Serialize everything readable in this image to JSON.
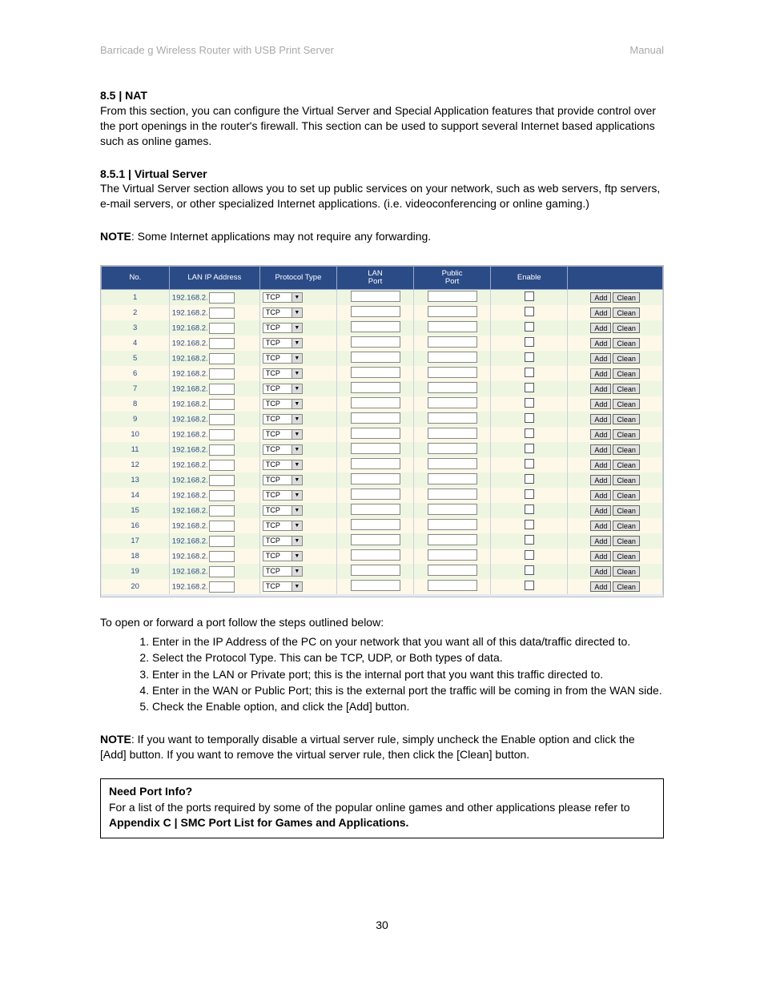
{
  "header": {
    "left": "Barricade g Wireless Router with USB Print Server",
    "right": "Manual"
  },
  "sec1": {
    "title": "8.5 | NAT",
    "text": "From this section, you can configure the Virtual Server and Special Application features that provide control over the port openings in the router's firewall. This section can be used to support several Internet based applications such as online games."
  },
  "sec2": {
    "title": "8.5.1 | Virtual Server",
    "text": "The Virtual Server section allows you to set up public services on your network, such as web servers, ftp servers, e-mail servers, or other specialized Internet applications. (i.e. videoconferencing or online gaming.)"
  },
  "note1": {
    "label": "NOTE",
    "text": ": Some Internet applications may not require any forwarding."
  },
  "vs": {
    "headers": {
      "no": "No.",
      "ip": "LAN IP Address",
      "proto": "Protocol Type",
      "lan": "LAN\nPort",
      "pub": "Public\nPort",
      "enable": "Enable",
      "actions": ""
    },
    "ip_prefix": "192.168.2.",
    "protocol_value": "TCP",
    "btn_add": "Add",
    "btn_clean": "Clean",
    "rows": [
      "1",
      "2",
      "3",
      "4",
      "5",
      "6",
      "7",
      "8",
      "9",
      "10",
      "11",
      "12",
      "13",
      "14",
      "15",
      "16",
      "17",
      "18",
      "19",
      "20"
    ]
  },
  "after_shot": "To open or forward a port follow the steps outlined below:",
  "steps": [
    "Enter in the IP Address of the PC on your network that you want all of this data/traffic directed to.",
    "Select the Protocol Type. This can be TCP, UDP, or Both types of data.",
    "Enter in the LAN or Private port; this is the internal port that you want this traffic directed to.",
    "Enter in the WAN or Public Port; this is the external port the traffic will be coming in from the WAN side.",
    "Check the Enable option, and click the [Add] button."
  ],
  "note2": {
    "label": "NOTE",
    "text": ": If you want to temporally disable a virtual server rule, simply uncheck the Enable option and click the [Add] button.  If you want to remove the virtual server rule, then click the [Clean] button."
  },
  "infobox": {
    "title": "Need Port Info?",
    "body_a": "For a list of the ports required by some of the popular online games and other applications please refer to ",
    "body_b": "Appendix C | SMC Port List for Games and Applications."
  },
  "page_number": "30"
}
